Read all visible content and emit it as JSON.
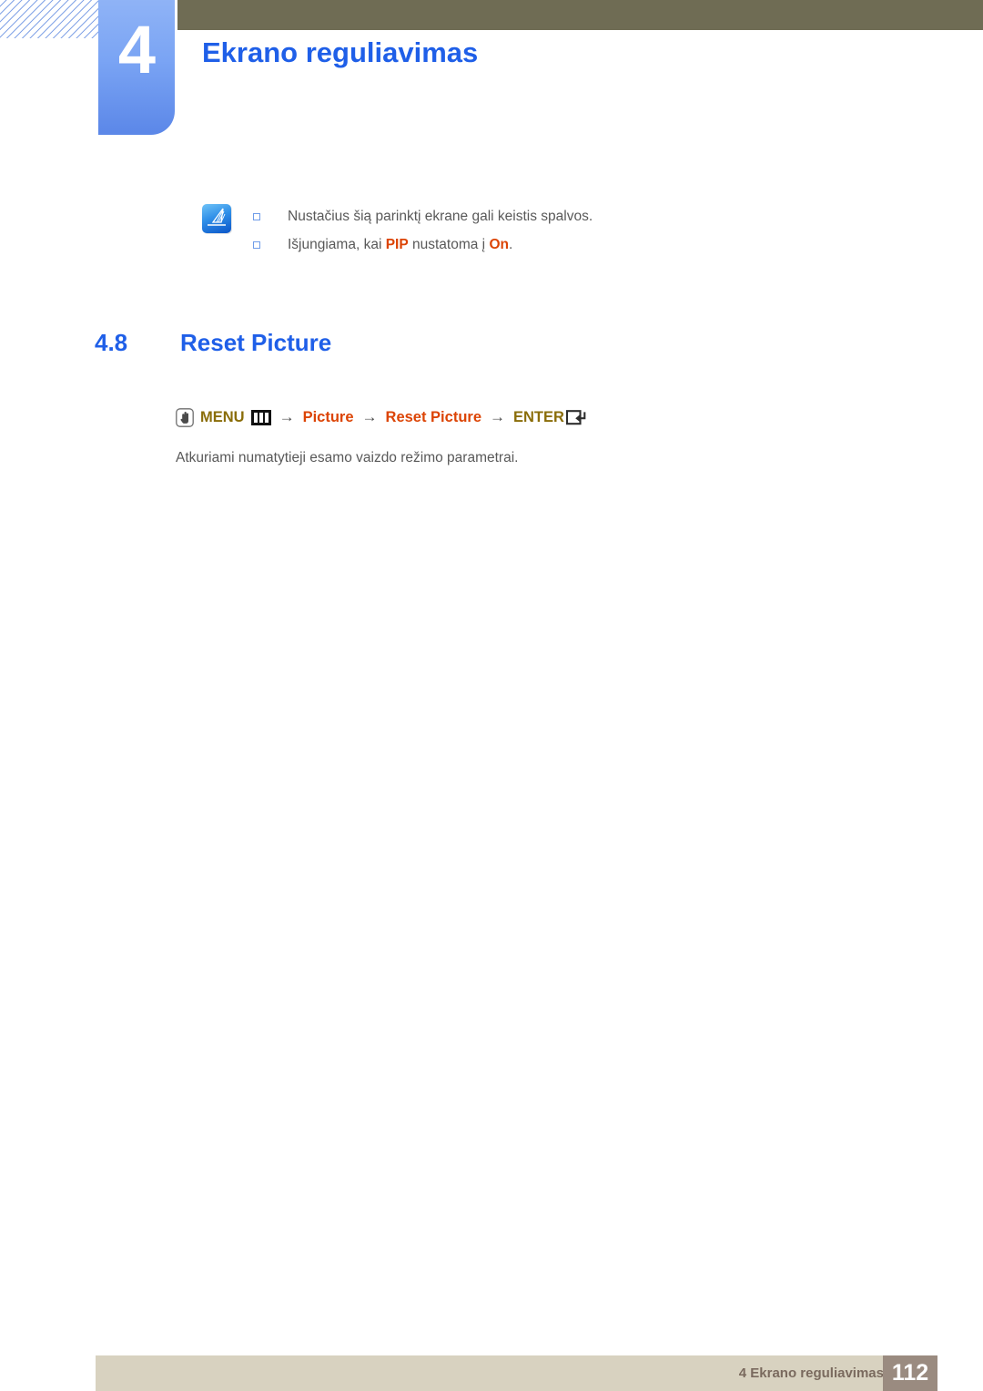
{
  "page": {
    "chapter_number": "4",
    "chapter_title": "Ekrano reguliavimas",
    "colors": {
      "chapter_blue": "#1f5fe8",
      "tab_blue": "#7aa4f4",
      "header_olive": "#6f6c54",
      "accent_orange": "#dc4405",
      "menu_gold": "#8a6d09",
      "body_gray": "#595959",
      "footer_beige": "#d8d2c0",
      "footer_page_taupe": "#9a8b80",
      "hatch_blue": "#7ea0e6"
    }
  },
  "note": {
    "icon_name": "note-pen-icon",
    "items": [
      {
        "text_before": "Nustačius šią parinktį ekrane gali keistis spalvos.",
        "accent_1": "",
        "text_middle": "",
        "accent_2": "",
        "text_after": ""
      },
      {
        "text_before": "Išjungiama, kai ",
        "accent_1": "PIP",
        "text_middle": " nustatoma į ",
        "accent_2": "On",
        "text_after": "."
      }
    ]
  },
  "section": {
    "number": "4.8",
    "title": "Reset Picture"
  },
  "menu_path": {
    "hand_icon": "hand-press-icon",
    "menu_label": "MENU",
    "menu_icon": "menu-grid-icon",
    "arrow": "→",
    "step_1": "Picture",
    "step_2": "Reset Picture",
    "enter_label": "ENTER",
    "enter_icon": "enter-key-icon"
  },
  "body": {
    "paragraph": "Atkuriami numatytieji esamo vaizdo režimo parametrai."
  },
  "footer": {
    "text": "4 Ekrano reguliavimas",
    "page_number": "112"
  }
}
